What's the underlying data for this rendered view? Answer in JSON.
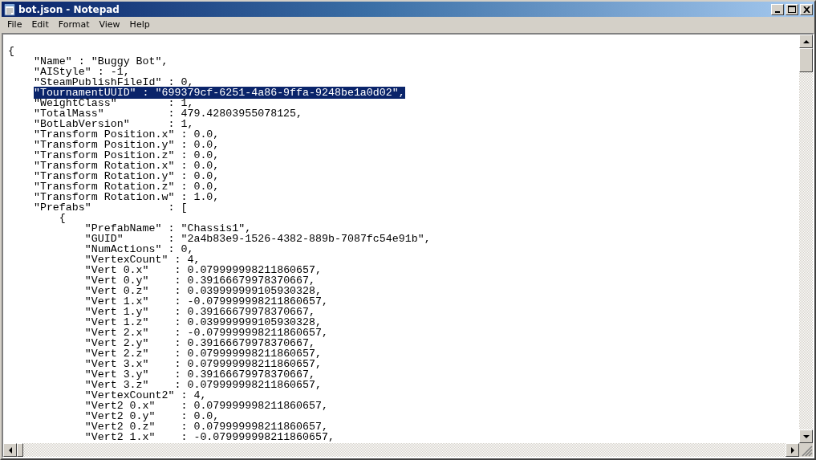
{
  "window": {
    "title": "bot.json - Notepad"
  },
  "menu": [
    "File",
    "Edit",
    "Format",
    "View",
    "Help"
  ],
  "lines": [
    {
      "text": "{",
      "selected": false
    },
    {
      "text": "    \"Name\" : \"Buggy Bot\",",
      "selected": false
    },
    {
      "text": "    \"AIStyle\" : -1,",
      "selected": false
    },
    {
      "text": "    \"SteamPublishFileId\" : 0,",
      "selected": false
    },
    {
      "text": "    \"TournamentUUID\" : \"699379cf-6251-4a86-9ffa-9248be1a0d02\",",
      "selected": true
    },
    {
      "text": "    \"WeightClass\"        : 1,",
      "selected": false
    },
    {
      "text": "    \"TotalMass\"          : 479.42803955078125,",
      "selected": false
    },
    {
      "text": "    \"BotLabVersion\"      : 1,",
      "selected": false
    },
    {
      "text": "    \"Transform Position.x\" : 0.0,",
      "selected": false
    },
    {
      "text": "    \"Transform Position.y\" : 0.0,",
      "selected": false
    },
    {
      "text": "    \"Transform Position.z\" : 0.0,",
      "selected": false
    },
    {
      "text": "    \"Transform Rotation.x\" : 0.0,",
      "selected": false
    },
    {
      "text": "    \"Transform Rotation.y\" : 0.0,",
      "selected": false
    },
    {
      "text": "    \"Transform Rotation.z\" : 0.0,",
      "selected": false
    },
    {
      "text": "    \"Transform Rotation.w\" : 1.0,",
      "selected": false
    },
    {
      "text": "    \"Prefabs\"            : [",
      "selected": false
    },
    {
      "text": "        {",
      "selected": false
    },
    {
      "text": "            \"PrefabName\" : \"Chassis1\",",
      "selected": false
    },
    {
      "text": "            \"GUID\"       : \"2a4b83e9-1526-4382-889b-7087fc54e91b\",",
      "selected": false
    },
    {
      "text": "            \"NumActions\" : 0,",
      "selected": false
    },
    {
      "text": "            \"VertexCount\" : 4,",
      "selected": false
    },
    {
      "text": "            \"Vert 0.x\"    : 0.079999998211860657,",
      "selected": false
    },
    {
      "text": "            \"Vert 0.y\"    : 0.39166679978370667,",
      "selected": false
    },
    {
      "text": "            \"Vert 0.z\"    : 0.039999999105930328,",
      "selected": false
    },
    {
      "text": "            \"Vert 1.x\"    : -0.079999998211860657,",
      "selected": false
    },
    {
      "text": "            \"Vert 1.y\"    : 0.39166679978370667,",
      "selected": false
    },
    {
      "text": "            \"Vert 1.z\"    : 0.039999999105930328,",
      "selected": false
    },
    {
      "text": "            \"Vert 2.x\"    : -0.079999998211860657,",
      "selected": false
    },
    {
      "text": "            \"Vert 2.y\"    : 0.39166679978370667,",
      "selected": false
    },
    {
      "text": "            \"Vert 2.z\"    : 0.079999998211860657,",
      "selected": false
    },
    {
      "text": "            \"Vert 3.x\"    : 0.079999998211860657,",
      "selected": false
    },
    {
      "text": "            \"Vert 3.y\"    : 0.39166679978370667,",
      "selected": false
    },
    {
      "text": "            \"Vert 3.z\"    : 0.079999998211860657,",
      "selected": false
    },
    {
      "text": "            \"VertexCount2\" : 4,",
      "selected": false
    },
    {
      "text": "            \"Vert2 0.x\"    : 0.079999998211860657,",
      "selected": false
    },
    {
      "text": "            \"Vert2 0.y\"    : 0.0,",
      "selected": false
    },
    {
      "text": "            \"Vert2 0.z\"    : 0.079999998211860657,",
      "selected": false
    },
    {
      "text": "            \"Vert2 1.x\"    : -0.079999998211860657,",
      "selected": false
    }
  ]
}
